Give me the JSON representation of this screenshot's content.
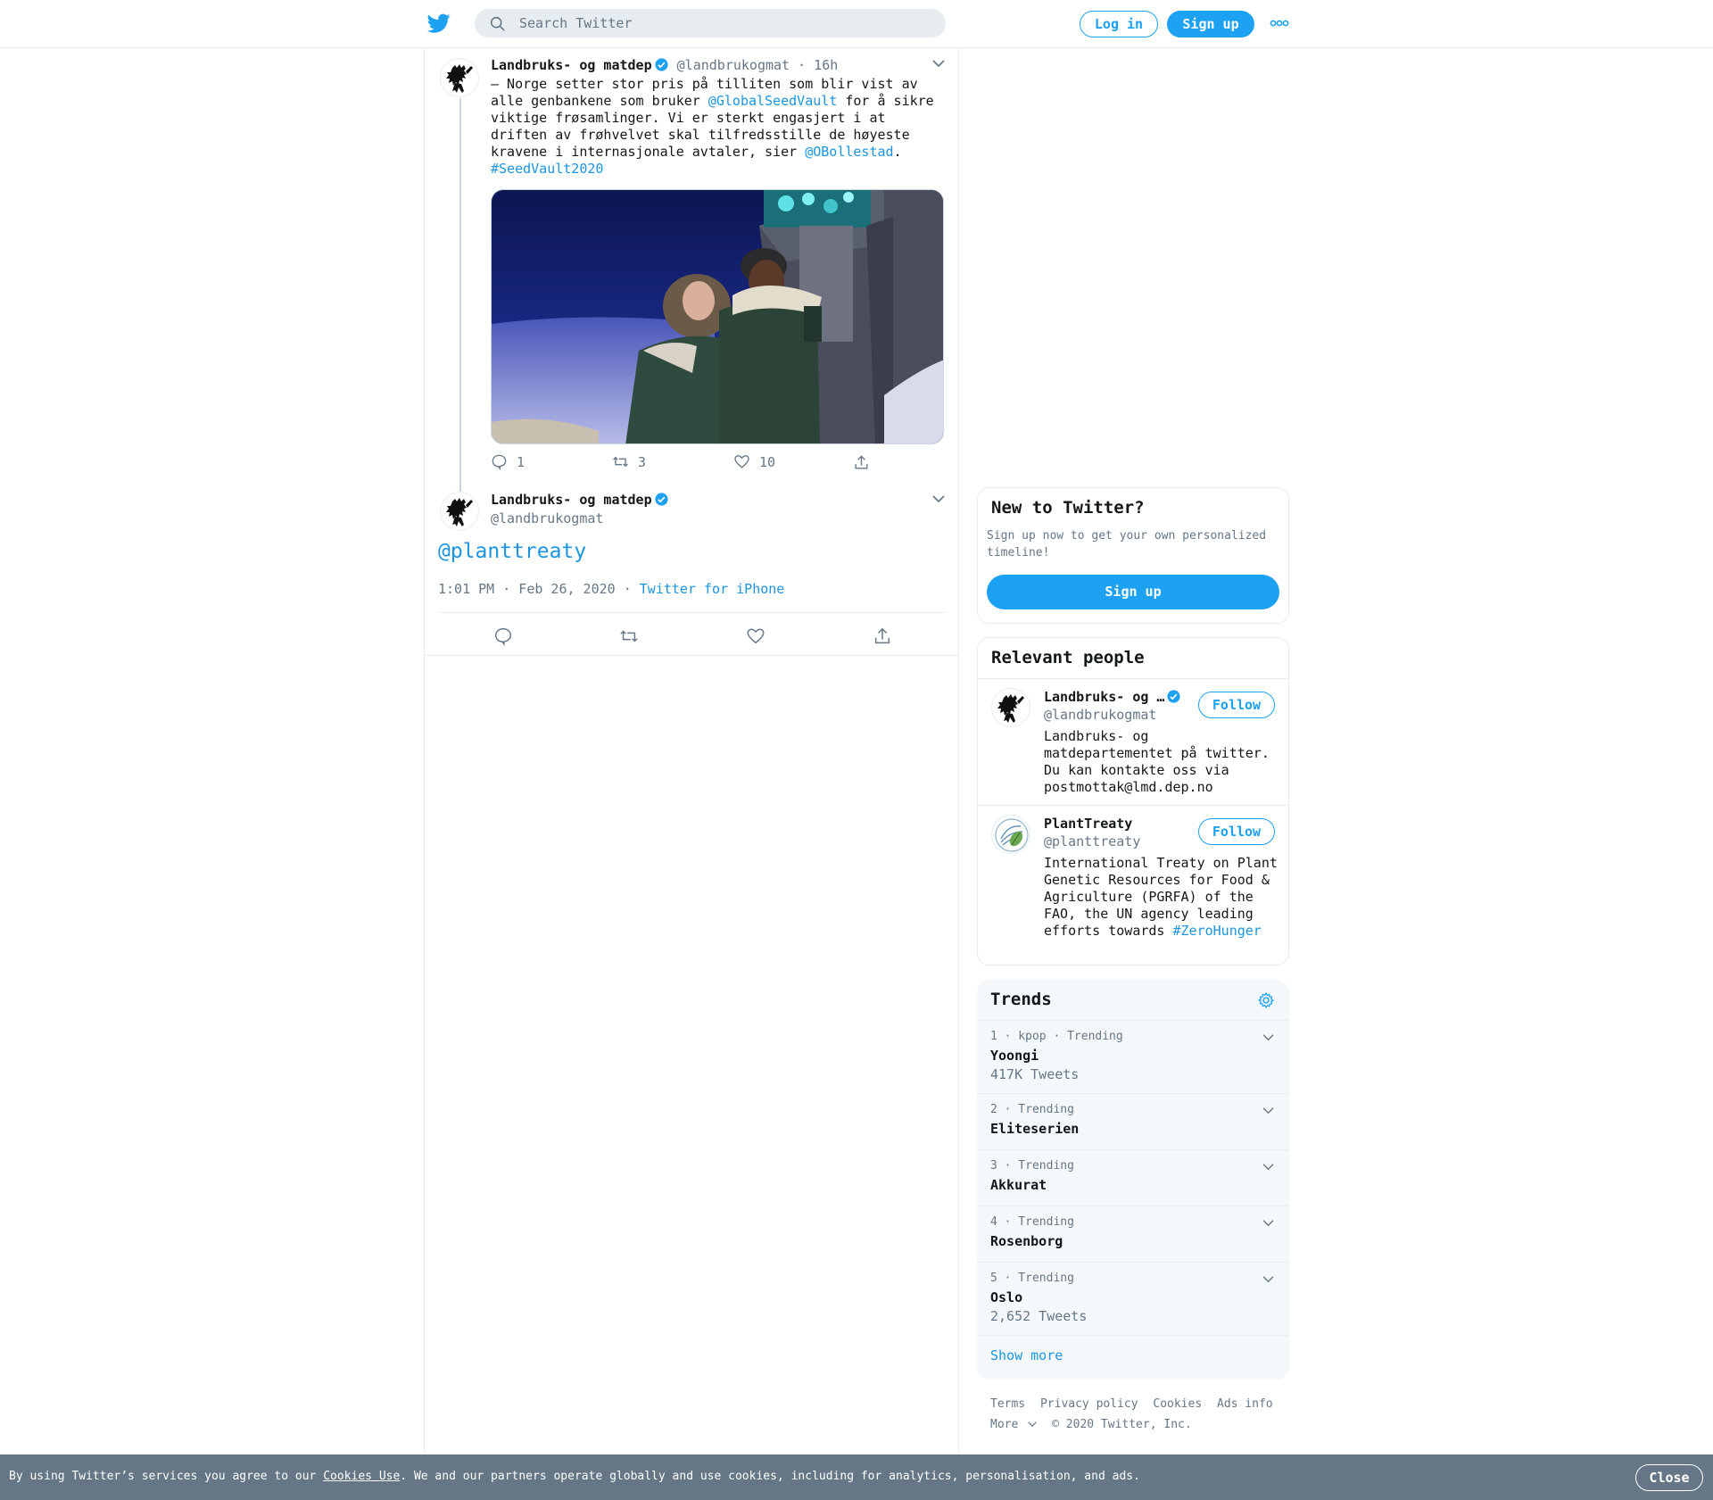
{
  "header": {
    "search_placeholder": "Search Twitter",
    "login_label": "Log in",
    "signup_label": "Sign up",
    "logo_icon": "twitter-bird-icon",
    "more_icon": "more-dots-icon"
  },
  "parent_tweet": {
    "name": "Landbruks- og matdep",
    "handle": "@landbrukogmat",
    "time": "· 16h",
    "text": {
      "part1": "– Norge setter stor pris på tilliten som blir vist av alle genbankene som bruker ",
      "mention1": "@GlobalSeedVault",
      "part2": " for å sikre viktige frøsamlinger. Vi er sterkt engasjert i at driften av frøhvelvet skal tilfredsstille de høyeste kravene i internasjonale avtaler, sier ",
      "mention2": "@OBollestad",
      "part3": ".",
      "hashtag": "#SeedVault2020"
    },
    "replies": "1",
    "retweets": "3",
    "likes": "10"
  },
  "main_tweet": {
    "name": "Landbruks- og matdep",
    "handle": "@landbrukogmat",
    "text": "@planttreaty",
    "timestamp": "1:01 PM · Feb 26, 2020",
    "separator": "·",
    "source": "Twitter for iPhone"
  },
  "signup_card": {
    "title": "New to Twitter?",
    "description": "Sign up now to get your own personalized timeline!",
    "button": "Sign up"
  },
  "relevant_people": {
    "title": "Relevant people",
    "people": [
      {
        "name": "Landbruks- og …",
        "handle": "@landbrukogmat",
        "bio": "Landbruks- og matdepartementet på twitter. Du kan kontakte oss via postmottak@lmd.dep.no",
        "follow": "Follow"
      },
      {
        "name": "PlantTreaty",
        "handle": "@planttreaty",
        "bio": "International Treaty on Plant Genetic Resources for Food & Agriculture (PGRFA) of the FAO, the UN agency leading efforts towards ",
        "bio_hashtag": "#ZeroHunger",
        "follow": "Follow"
      }
    ]
  },
  "trends": {
    "title": "Trends",
    "items": [
      {
        "meta": "1 · kpop · Trending",
        "name": "Yoongi",
        "count": "417K Tweets"
      },
      {
        "meta": "2 · Trending",
        "name": "Eliteserien",
        "count": ""
      },
      {
        "meta": "3 · Trending",
        "name": "Akkurat",
        "count": ""
      },
      {
        "meta": "4 · Trending",
        "name": "Rosenborg",
        "count": ""
      },
      {
        "meta": "5 · Trending",
        "name": "Oslo",
        "count": "2,652 Tweets"
      }
    ],
    "show_more": "Show more"
  },
  "footer": {
    "links": [
      "Terms",
      "Privacy policy",
      "Cookies",
      "Ads info"
    ],
    "more": "More",
    "copyright": "© 2020 Twitter, Inc."
  },
  "cookie_bar": {
    "text_before": "By using Twitter’s services you agree to our ",
    "link": "Cookies Use",
    "text_after": ". We and our partners operate globally and use cookies, including for analytics, personalisation, and ads.",
    "close": "Close"
  },
  "colors": {
    "accent": "#1da1f2",
    "link": "#1b95e0",
    "muted": "#657786",
    "border": "#e6ecf0",
    "cookie_bg": "#657786"
  }
}
